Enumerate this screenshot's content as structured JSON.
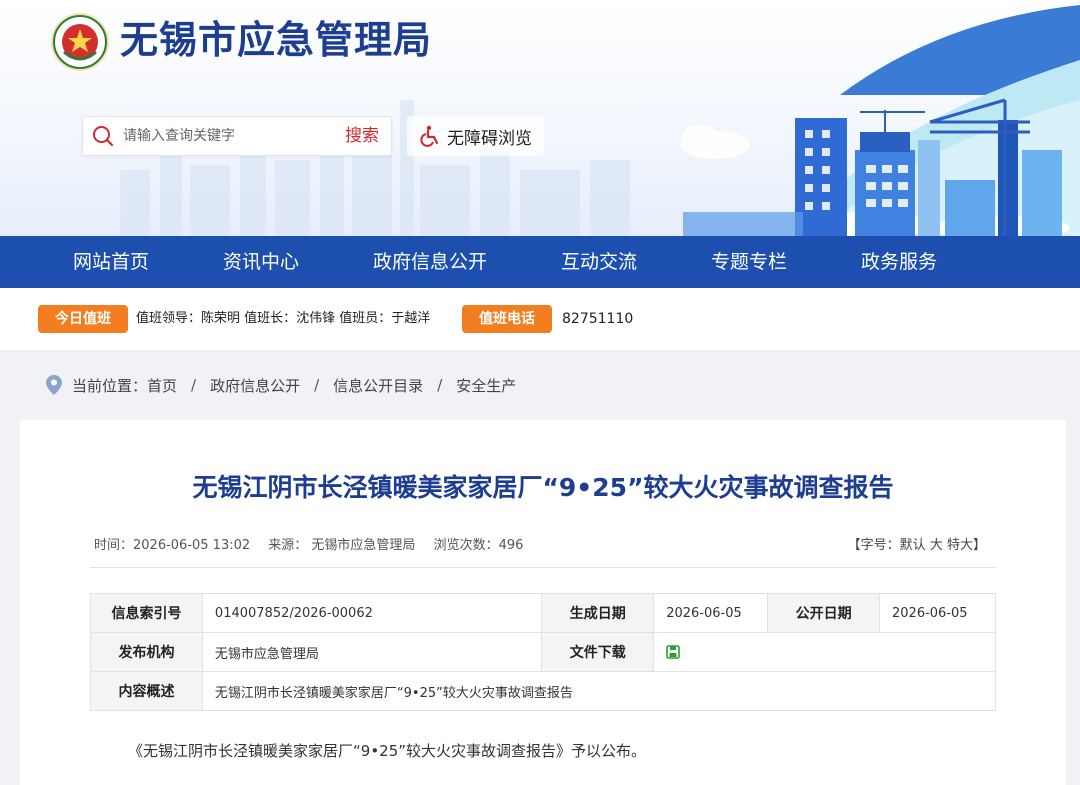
{
  "header": {
    "site_title": "无锡市应急管理局",
    "logo_icon": "emergency-management-emblem",
    "search": {
      "placeholder": "请输入查询关键字",
      "button_label": "搜索"
    },
    "accessibility_label": "无障碍浏览"
  },
  "nav": {
    "items": [
      {
        "label": "网站首页"
      },
      {
        "label": "资讯中心"
      },
      {
        "label": "政府信息公开"
      },
      {
        "label": "互动交流"
      },
      {
        "label": "专题专栏"
      },
      {
        "label": "政务服务"
      }
    ]
  },
  "duty": {
    "today_badge": "今日值班",
    "duty_info": "值班领导：陈荣明  值班长：沈伟锋  值班员：于越洋",
    "phone_badge": "值班电话",
    "phone": "82751110"
  },
  "breadcrumb": {
    "prefix": "当前位置：",
    "items": [
      "首页",
      "政府信息公开",
      "信息公开目录",
      "安全生产"
    ],
    "separator": "/"
  },
  "article": {
    "title": "无锡江阴市长泾镇暖美家家居厂“9•25”较大火灾事故调查报告",
    "meta": {
      "time": "时间：2026-06-05 13:02",
      "source": "来源： 无锡市应急管理局",
      "views": "浏览次数：496"
    },
    "font_size": {
      "prefix": "【字号：",
      "default": "默认",
      "large": "大",
      "xlarge": "特大",
      "suffix": "】"
    },
    "info_table": {
      "index_label": "信息索引号",
      "index_value": "014007852/2026-00062",
      "created_label": "生成日期",
      "created_value": "2026-06-05",
      "published_label": "公开日期",
      "published_value": "2026-06-05",
      "org_label": "发布机构",
      "org_value": "无锡市应急管理局",
      "download_label": "文件下载",
      "summary_label": "内容概述",
      "summary_value": "无锡江阴市长泾镇暖美家家居厂“9•25”较大火灾事故调查报告"
    },
    "body": "《无锡江阴市长泾镇暖美家家居厂“9•25”较大火灾事故调查报告》予以公布。"
  },
  "colors": {
    "primary_blue": "#1d4fae",
    "title_blue": "#1d3d93",
    "accent_orange": "#f37e21",
    "search_red": "#d6262e"
  }
}
